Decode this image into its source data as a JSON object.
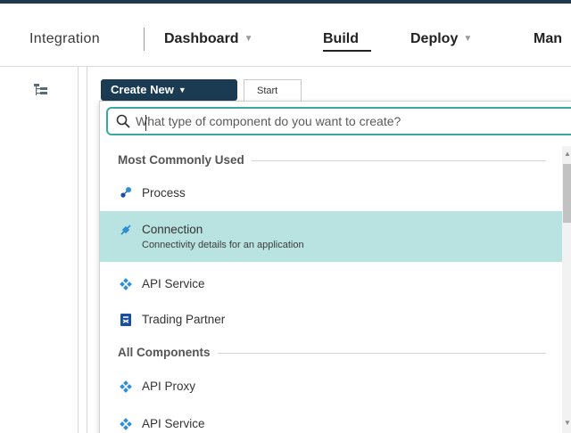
{
  "nav": {
    "brand": "Integration",
    "items": [
      {
        "label": "Dashboard",
        "has_menu": true
      },
      {
        "label": "Build",
        "has_menu": false,
        "active": true
      },
      {
        "label": "Deploy",
        "has_menu": true
      },
      {
        "label": "Man"
      }
    ]
  },
  "toolbar": {
    "create_new_label": "Create New",
    "start_tab_label": "Start"
  },
  "dropdown": {
    "search_placeholder": "What type of component do you want to create?",
    "sections": [
      {
        "title": "Most Commonly Used",
        "items": [
          {
            "label": "Process",
            "icon": "process-icon"
          },
          {
            "label": "Connection",
            "description": "Connectivity details for an application",
            "icon": "connection-icon",
            "highlighted": true
          },
          {
            "label": "API Service",
            "icon": "api-service-icon"
          },
          {
            "label": "Trading Partner",
            "icon": "trading-partner-icon"
          }
        ]
      },
      {
        "title": "All Components",
        "items": [
          {
            "label": "API Proxy",
            "icon": "api-proxy-icon"
          },
          {
            "label": "API Service",
            "icon": "api-service-icon"
          }
        ]
      }
    ]
  },
  "colors": {
    "top_border": "#1f3a4d",
    "create_button": "#1b3b53",
    "search_focus": "#3aa7a0",
    "highlight_row": "#b8e3e0",
    "icon_blue": "#2d8fd5",
    "icon_navy": "#1a4fa0"
  }
}
